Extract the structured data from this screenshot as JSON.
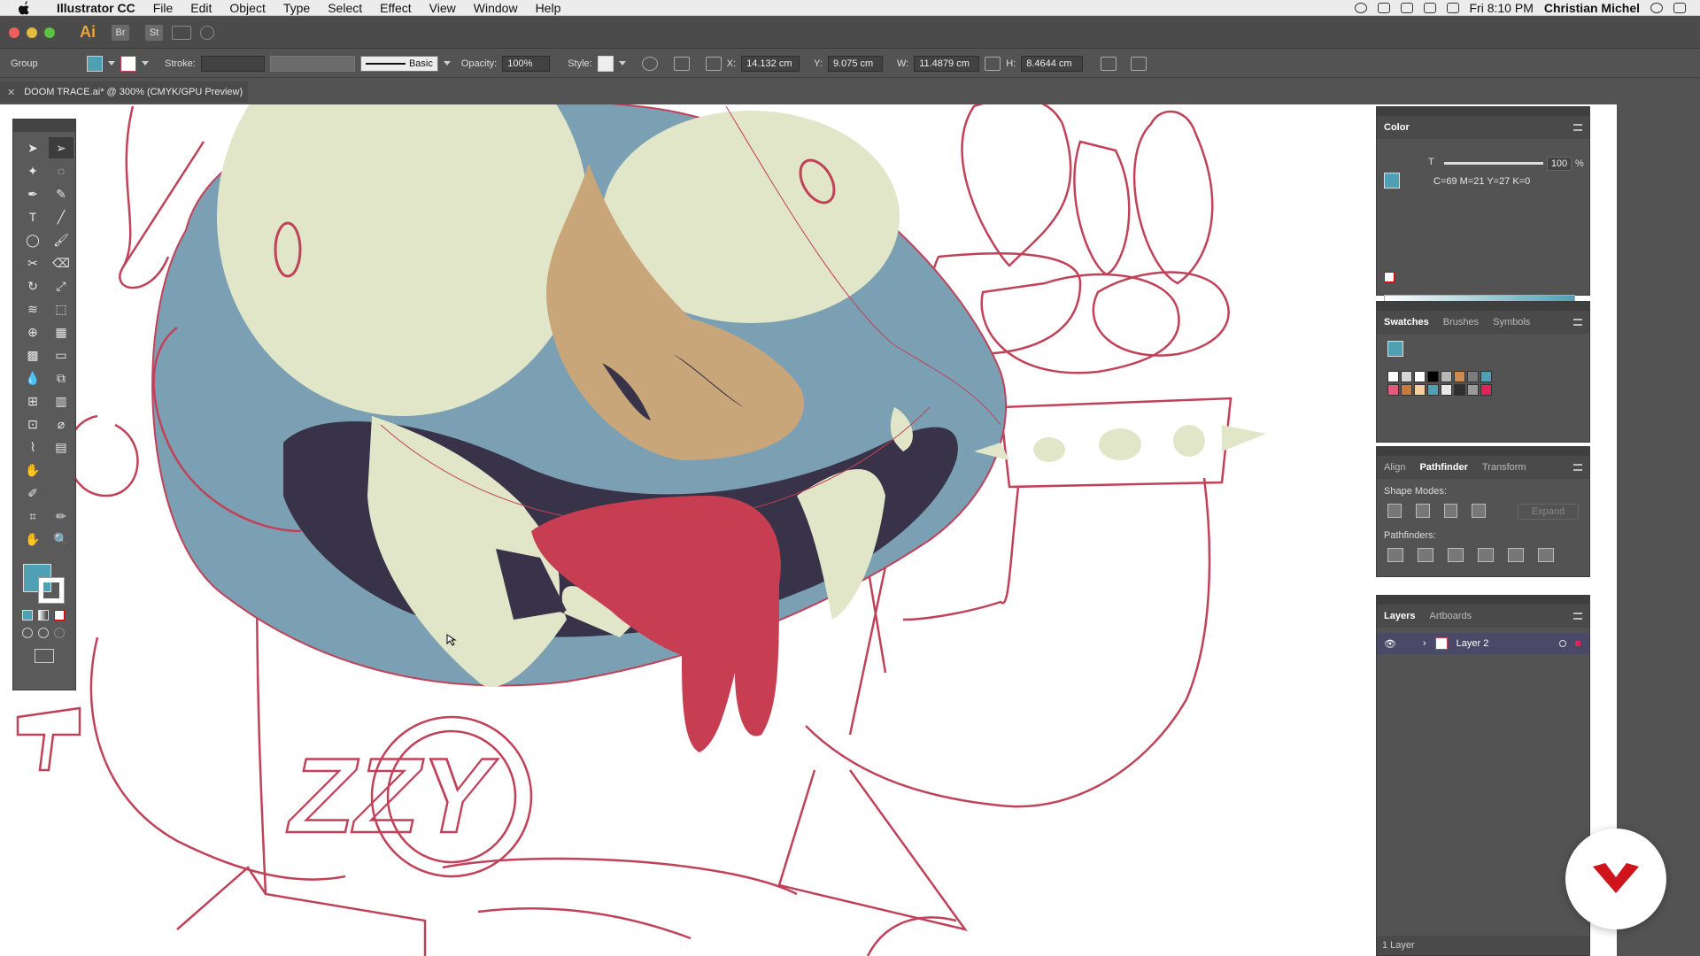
{
  "menubar": {
    "app_name": "Illustrator CC",
    "items": [
      "File",
      "Edit",
      "Object",
      "Type",
      "Select",
      "Effect",
      "View",
      "Window",
      "Help"
    ],
    "clock": "Fri 8:10 PM",
    "user": "Christian Michel"
  },
  "appbar": {
    "logo": "Ai",
    "bridge": "Br",
    "stock": "St"
  },
  "controlbar": {
    "selection": "Group",
    "stroke_label": "Stroke:",
    "brush_label": "Basic",
    "opacity_label": "Opacity:",
    "opacity_value": "100%",
    "style_label": "Style:",
    "x_label": "X:",
    "x_value": "14.132 cm",
    "y_label": "Y:",
    "y_value": "9.075 cm",
    "w_label": "W:",
    "w_value": "11.4879 cm",
    "h_label": "H:",
    "h_value": "8.4644 cm"
  },
  "document": {
    "tab_title": "DOOM TRACE.ai* @ 300% (CMYK/GPU Preview)",
    "text_on_artwork": "ZZY"
  },
  "color_panel": {
    "title": "Color",
    "tint_label": "T",
    "tint_value": "100",
    "percent": "%",
    "readout": "C=69 M=21 Y=27 K=0",
    "fill_color": "#4fa0b5"
  },
  "swatches_panel": {
    "tabs": [
      "Swatches",
      "Brushes",
      "Symbols"
    ],
    "swatch_colors": [
      "#ffffff",
      "#d6d6d6",
      "#ffffff",
      "#000000",
      "#b8b8b8",
      "#d08a50",
      "#7b7b7b",
      "#4fa0b5",
      "#e05a7a",
      "#c97a3a",
      "#f2d0a0",
      "#4fa0b5",
      "#e8e8e8",
      "#2f2f2f",
      "#9a9a9a",
      "#e0245a"
    ]
  },
  "pathfinder_panel": {
    "tabs": [
      "Align",
      "Pathfinder",
      "Transform"
    ],
    "shape_modes_label": "Shape Modes:",
    "expand_label": "Expand",
    "pathfinders_label": "Pathfinders:"
  },
  "layers_panel": {
    "tabs": [
      "Layers",
      "Artboards"
    ],
    "layer_name": "Layer 2",
    "footer": "1 Layer"
  },
  "colors": {
    "accent_blue": "#4fa0b5",
    "outline_red": "#c04258",
    "face_blue": "#7ba0b3",
    "eye_cream": "#e2e6c9",
    "nose_tan": "#c9a679",
    "mouth_dark": "#383348",
    "tongue_red": "#c73d52"
  }
}
